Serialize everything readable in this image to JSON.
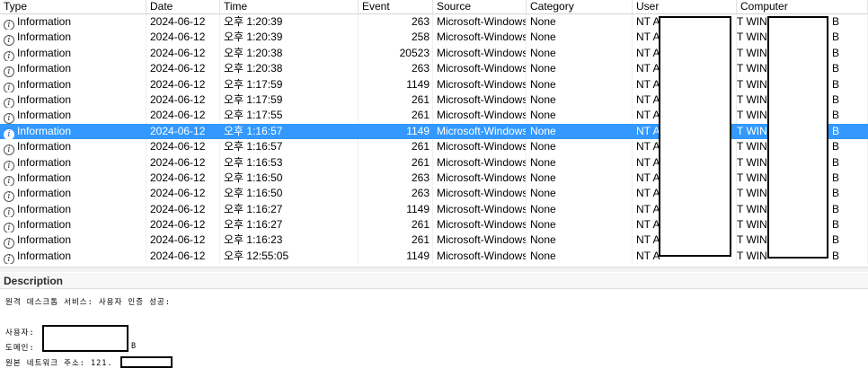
{
  "columns": {
    "type": "Type",
    "date": "Date",
    "time": "Time",
    "event": "Event",
    "source": "Source",
    "category": "Category",
    "user": "User",
    "computer": "Computer"
  },
  "rows": [
    {
      "type": "Information",
      "date": "2024-06-12",
      "time": "오후 1:20:39",
      "event": "263",
      "source": "Microsoft-Windows-",
      "category": "None",
      "user": "NT A",
      "computer_pre": "T WIN-",
      "computer_post": "B"
    },
    {
      "type": "Information",
      "date": "2024-06-12",
      "time": "오후 1:20:39",
      "event": "258",
      "source": "Microsoft-Windows-",
      "category": "None",
      "user": "NT A",
      "computer_pre": "T WIN-",
      "computer_post": "B"
    },
    {
      "type": "Information",
      "date": "2024-06-12",
      "time": "오후 1:20:38",
      "event": "20523",
      "source": "Microsoft-Windows-",
      "category": "None",
      "user": "NT A",
      "computer_pre": "T WIN-",
      "computer_post": "B"
    },
    {
      "type": "Information",
      "date": "2024-06-12",
      "time": "오후 1:20:38",
      "event": "263",
      "source": "Microsoft-Windows-",
      "category": "None",
      "user": "NT A",
      "computer_pre": "T WIN-",
      "computer_post": "B"
    },
    {
      "type": "Information",
      "date": "2024-06-12",
      "time": "오후 1:17:59",
      "event": "1149",
      "source": "Microsoft-Windows-",
      "category": "None",
      "user": "NT A",
      "computer_pre": "T WIN-",
      "computer_post": "B"
    },
    {
      "type": "Information",
      "date": "2024-06-12",
      "time": "오후 1:17:59",
      "event": "261",
      "source": "Microsoft-Windows-",
      "category": "None",
      "user": "NT A",
      "computer_pre": "T WIN-",
      "computer_post": "B"
    },
    {
      "type": "Information",
      "date": "2024-06-12",
      "time": "오후 1:17:55",
      "event": "261",
      "source": "Microsoft-Windows-",
      "category": "None",
      "user": "NT A",
      "computer_pre": "T WIN-",
      "computer_post": "B"
    },
    {
      "type": "Information",
      "date": "2024-06-12",
      "time": "오후 1:16:57",
      "event": "1149",
      "source": "Microsoft-Windows-",
      "category": "None",
      "user": "NT A",
      "computer_pre": "T WIN-",
      "computer_post": "B",
      "selected": true
    },
    {
      "type": "Information",
      "date": "2024-06-12",
      "time": "오후 1:16:57",
      "event": "261",
      "source": "Microsoft-Windows-",
      "category": "None",
      "user": "NT A",
      "computer_pre": "T WIN-",
      "computer_post": "B"
    },
    {
      "type": "Information",
      "date": "2024-06-12",
      "time": "오후 1:16:53",
      "event": "261",
      "source": "Microsoft-Windows-",
      "category": "None",
      "user": "NT A",
      "computer_pre": "T WIN-",
      "computer_post": "B"
    },
    {
      "type": "Information",
      "date": "2024-06-12",
      "time": "오후 1:16:50",
      "event": "263",
      "source": "Microsoft-Windows-",
      "category": "None",
      "user": "NT A",
      "computer_pre": "T WIN-",
      "computer_post": "B"
    },
    {
      "type": "Information",
      "date": "2024-06-12",
      "time": "오후 1:16:50",
      "event": "263",
      "source": "Microsoft-Windows-",
      "category": "None",
      "user": "NT A",
      "computer_pre": "T WIN-",
      "computer_post": "B"
    },
    {
      "type": "Information",
      "date": "2024-06-12",
      "time": "오후 1:16:27",
      "event": "1149",
      "source": "Microsoft-Windows-",
      "category": "None",
      "user": "NT A",
      "computer_pre": "T WIN-",
      "computer_post": "B"
    },
    {
      "type": "Information",
      "date": "2024-06-12",
      "time": "오후 1:16:27",
      "event": "261",
      "source": "Microsoft-Windows-",
      "category": "None",
      "user": "NT A",
      "computer_pre": "T WIN-",
      "computer_post": "B"
    },
    {
      "type": "Information",
      "date": "2024-06-12",
      "time": "오후 1:16:23",
      "event": "261",
      "source": "Microsoft-Windows-",
      "category": "None",
      "user": "NT A",
      "computer_pre": "T WIN-",
      "computer_post": "B"
    },
    {
      "type": "Information",
      "date": "2024-06-12",
      "time": "오후 12:55:05",
      "event": "1149",
      "source": "Microsoft-Windows-",
      "category": "None",
      "user": "NT A",
      "computer_pre": "T WIN-",
      "computer_post": "B"
    }
  ],
  "description": {
    "title": "Description",
    "line1": "원격 데스크톱 서비스: 사용자 인증 성공:",
    "user_label": "사용자:",
    "domain_label": "도메인:",
    "domain_suffix": "B",
    "source_addr_label": "원본 네트워크 주소: 121."
  },
  "icons": {
    "row_icon": "info-circle-icon"
  },
  "colors": {
    "selection": "#3399ff",
    "selection_text": "#ffffff"
  }
}
